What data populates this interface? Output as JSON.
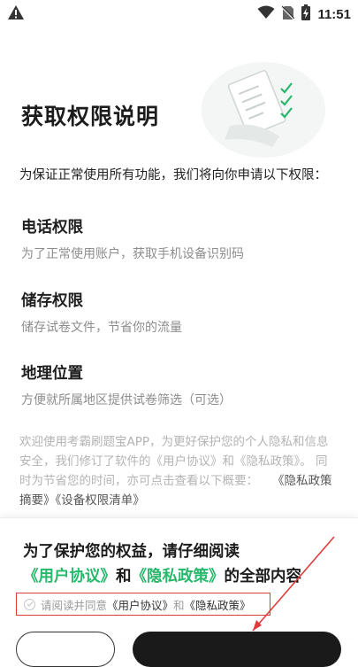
{
  "status_bar": {
    "time": "11:51",
    "icons": [
      "alert-icon",
      "wifi-icon",
      "no-sim-icon",
      "battery-charging-icon"
    ]
  },
  "header": {
    "title": "获取权限说明",
    "illustration": "document-checklist-icon"
  },
  "intro": "为保证正常使用所有功能，我们将向你申请以下权限：",
  "permissions": [
    {
      "title": "电话权限",
      "desc": "为了正常使用账户，获取手机设备识别码"
    },
    {
      "title": "储存权限",
      "desc": "储存试卷文件，节省你的流量"
    },
    {
      "title": "地理位置",
      "desc": "方便就所属地区提供试卷筛选（可选）"
    }
  ],
  "notice": {
    "text": "欢迎使用考霸刷题宝APP，为更好保护您的个人隐私和信息安全，我们修订了软件的《用户协议》和《隐私政策》。 同时为节省您的时间，亦可点击查看以下概要：",
    "link1": "《隐私政策摘要》",
    "link2": "《设备权限清单》"
  },
  "sheet": {
    "line1": "为了保护您的权益，请仔细阅读",
    "user_agreement": "《用户协议》",
    "and": "和",
    "privacy_policy": "《隐私政策》",
    "tail": "的全部内容",
    "agree_prefix": "请阅读并同意",
    "agree_user": "《用户协议》",
    "agree_and": "和",
    "agree_privacy": "《隐私政策》"
  },
  "colors": {
    "accent_green": "#27b86c",
    "highlight_red": "#e03b3b",
    "primary_button": "#1a1a1a"
  }
}
